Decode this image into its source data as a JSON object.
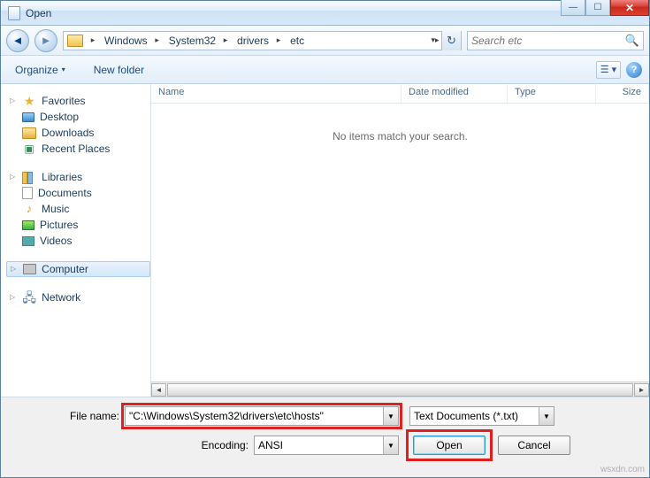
{
  "window": {
    "title": "Open"
  },
  "breadcrumb": {
    "segments": [
      "Windows",
      "System32",
      "drivers",
      "etc"
    ]
  },
  "search": {
    "placeholder": "Search etc"
  },
  "toolbar": {
    "organize": "Organize",
    "new_folder": "New folder"
  },
  "sidebar": {
    "favorites": {
      "label": "Favorites",
      "items": [
        "Desktop",
        "Downloads",
        "Recent Places"
      ]
    },
    "libraries": {
      "label": "Libraries",
      "items": [
        "Documents",
        "Music",
        "Pictures",
        "Videos"
      ]
    },
    "computer": {
      "label": "Computer"
    },
    "network": {
      "label": "Network"
    }
  },
  "filelist": {
    "columns": {
      "name": "Name",
      "date": "Date modified",
      "type": "Type",
      "size": "Size"
    },
    "empty_message": "No items match your search."
  },
  "form": {
    "filename_label": "File name:",
    "filename_value": "\"C:\\Windows\\System32\\drivers\\etc\\hosts\"",
    "filter_value": "Text Documents (*.txt)",
    "encoding_label": "Encoding:",
    "encoding_value": "ANSI",
    "open_label": "Open",
    "cancel_label": "Cancel"
  },
  "watermark": "wsxdn.com"
}
